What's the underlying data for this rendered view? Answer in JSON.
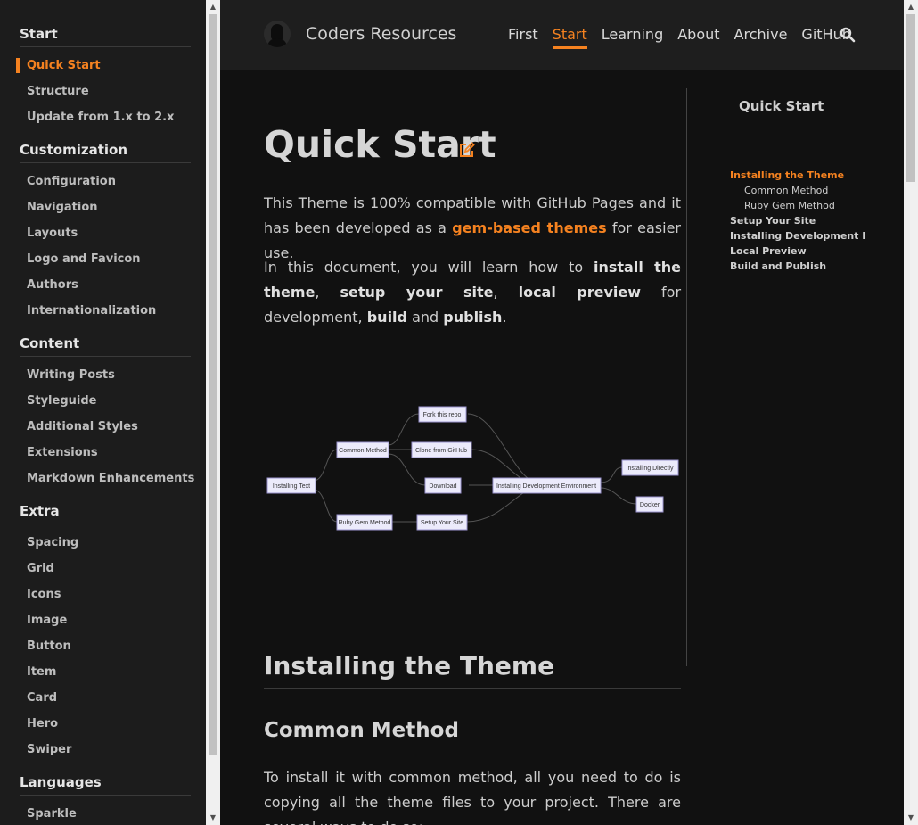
{
  "sidebar": {
    "sections": [
      {
        "title": "Start",
        "items": [
          "Quick Start",
          "Structure",
          "Update from 1.x to 2.x"
        ],
        "active": 0
      },
      {
        "title": "Customization",
        "items": [
          "Configuration",
          "Navigation",
          "Layouts",
          "Logo and Favicon",
          "Authors",
          "Internationalization"
        ]
      },
      {
        "title": "Content",
        "items": [
          "Writing Posts",
          "Styleguide",
          "Additional Styles",
          "Extensions",
          "Markdown Enhancements"
        ]
      },
      {
        "title": "Extra",
        "items": [
          "Spacing",
          "Grid",
          "Icons",
          "Image",
          "Button",
          "Item",
          "Card",
          "Hero",
          "Swiper"
        ]
      },
      {
        "title": "Languages",
        "items": [
          "Sparkle"
        ]
      }
    ]
  },
  "header": {
    "site_title": "Coders Resources",
    "nav": [
      "First",
      "Start",
      "Learning",
      "About",
      "Archive",
      "GitHub"
    ],
    "active_nav": "Start"
  },
  "article": {
    "title": "Quick Start",
    "intro": {
      "p1_a": "This Theme is 100% compatible with GitHub Pages and it has been developed as a ",
      "p1_link": "gem-based themes",
      "p1_b": " for easier use.",
      "p2_a": "In this document, you will learn how to ",
      "p2_b1": "install the theme",
      "p2_c": ", ",
      "p2_b2": "setup your site",
      "p2_d": ", ",
      "p2_b3": "local preview",
      "p2_e": " for development, ",
      "p2_b4": "build",
      "p2_f": " and ",
      "p2_b5": "publish",
      "p2_g": "."
    },
    "h2": "Installing the Theme",
    "h3": "Common Method",
    "p3": "To install it with common method, all you need to do is copying all the theme files to your project. There are several ways to do so:"
  },
  "diagram": {
    "nodes": {
      "install": "Installing Text",
      "common": "Common Method",
      "ruby": "Ruby Gem Method",
      "fork": "Fork this repo",
      "clone": "Clone from GitHub",
      "download": "Download",
      "setup": "Setup Your Site",
      "dev": "Installing Development Environment",
      "direct": "Installing Directly",
      "docker": "Docker"
    }
  },
  "toc": {
    "title": "Quick Start",
    "items": [
      {
        "label": "Installing the Theme",
        "level": 1,
        "active": true
      },
      {
        "label": "Common Method",
        "level": 2
      },
      {
        "label": "Ruby Gem Method",
        "level": 2
      },
      {
        "label": "Setup Your Site",
        "level": 1
      },
      {
        "label": "Installing Development Envir",
        "level": 1
      },
      {
        "label": "Local Preview",
        "level": 1
      },
      {
        "label": "Build and Publish",
        "level": 1
      }
    ]
  },
  "colors": {
    "accent": "#f58220",
    "background": "#111111",
    "sidebar": "#1c1c1c",
    "header": "#1e1e1e"
  }
}
